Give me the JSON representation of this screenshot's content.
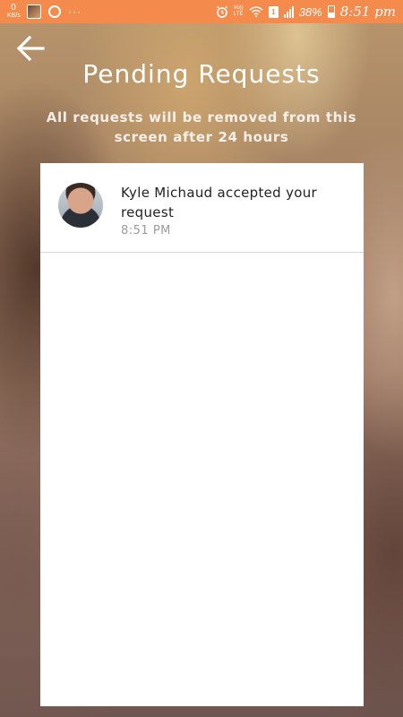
{
  "status_bar": {
    "net_speed_value": "0",
    "net_speed_unit": "KB/s",
    "more_dots": "···",
    "volte_line1": "Vo))",
    "volte_line2": "LTE",
    "sim_label": "1",
    "battery_percent": "38%",
    "time": "8:51 pm",
    "bar_color": "#f58a4d"
  },
  "header": {
    "back_icon": "arrow-left-icon",
    "title": "Pending Requests",
    "subtitle": "All requests will be removed from this screen after 24 hours"
  },
  "requests": [
    {
      "avatar_icon": "user-avatar",
      "message": "Kyle Michaud accepted your request",
      "time": "8:51 PM"
    }
  ]
}
